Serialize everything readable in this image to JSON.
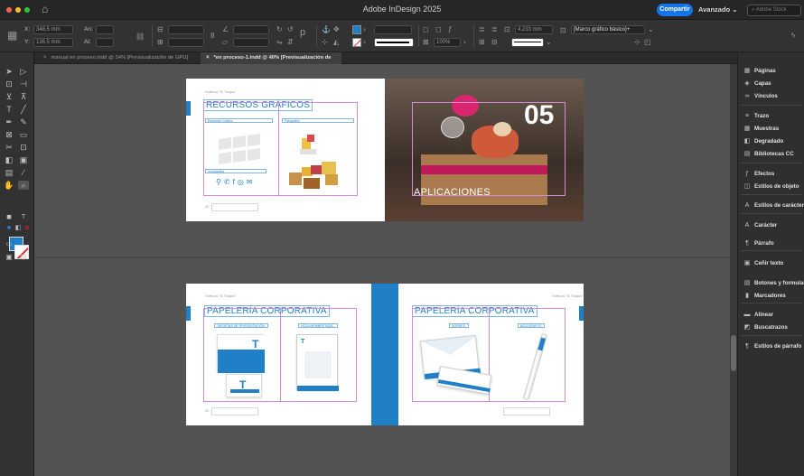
{
  "window": {
    "title": "Adobe InDesign 2025",
    "share_label": "Compartir",
    "workspace_label": "Avanzado",
    "stock_search_placeholder": "Adobe Stock",
    "traffic_colors": [
      "#fe5f57",
      "#febc2e",
      "#28c840"
    ]
  },
  "control_bar": {
    "x_label": "X:",
    "x_value": "348,5 mm",
    "y_label": "Y:",
    "y_value": "136,5 mm",
    "w_label": "An:",
    "h_label": "Al:",
    "stroke_weight": "4,233 mm",
    "zoom_percent": "100%",
    "frame_style": "[Marco gráfico básico]+"
  },
  "tabs": [
    {
      "label": "manual en proceso.indd @ 24% [Previsualización de GPU]",
      "active": false
    },
    {
      "label": "*en proceso-1.indd @ 40% [Previsualización de GPU]",
      "active": true
    }
  ],
  "tools": {
    "icons": [
      "selection-icon",
      "direct-selection-icon",
      "page-tool-icon",
      "gap-tool-icon",
      "content-collector-icon",
      "content-placer-icon",
      "type-tool-icon",
      "line-tool-icon",
      "pen-tool-icon",
      "pencil-tool-icon",
      "rectangle-frame-icon",
      "rectangle-icon",
      "scissors-icon",
      "free-transform-icon",
      "gradient-swatch-icon",
      "gradient-feather-icon",
      "note-icon",
      "eyedropper-icon",
      "hand-icon",
      "zoom-icon"
    ],
    "fill_color": "#1f7fc7",
    "stroke_color": "#ffffff"
  },
  "spread1": {
    "header_small": "Gráficos \"El Tinajon\"",
    "heading": "RECURSOS GRÁFICOS",
    "label_elements": "Elemento Gráfico",
    "label_photo": "Fotografía",
    "label_icon": "Iconografía",
    "number": "05",
    "section_title": "APLICACIONES",
    "footer_mark": "02"
  },
  "spread2": {
    "left_header_small": "Gráficos \"El Tinajon\"",
    "left_heading": "PAPELERÍA CORPORATIVA",
    "left_label_1": "TARJETAS DE PRESENTACIÓN",
    "left_label_2": "HOJA MEMBRETADA",
    "right_header_small": "Gráficos \"El Tinajon\"",
    "right_heading": "PAPELERÍA CORPORATIVA",
    "right_label_1": "SOBRES",
    "right_label_2": "BOLÍGRAFOS",
    "footer_mark": "02"
  },
  "panels": [
    {
      "icon": "pages-icon",
      "glyph": "▦",
      "label": "Páginas"
    },
    {
      "icon": "layers-icon",
      "glyph": "◈",
      "label": "Capas"
    },
    {
      "icon": "links-icon",
      "glyph": "∞",
      "label": "Vínculos"
    },
    {
      "icon": "stroke-icon",
      "glyph": "≡",
      "label": "Trazo"
    },
    {
      "icon": "swatches-icon",
      "glyph": "▦",
      "label": "Muestras"
    },
    {
      "icon": "gradient-icon",
      "glyph": "◧",
      "label": "Degradado"
    },
    {
      "icon": "cc-libraries-icon",
      "glyph": "▤",
      "label": "Bibliotecas CC"
    },
    {
      "icon": "effects-icon",
      "glyph": "ƒ",
      "label": "Efectos"
    },
    {
      "icon": "object-styles-icon",
      "glyph": "◫",
      "label": "Estilos de objeto"
    },
    {
      "icon": "character-styles-icon",
      "glyph": "A",
      "label": "Estilos de carácter"
    },
    {
      "icon": "character-icon",
      "glyph": "A",
      "label": "Carácter"
    },
    {
      "icon": "paragraph-icon",
      "glyph": "¶",
      "label": "Párrafo"
    },
    {
      "icon": "text-wrap-icon",
      "glyph": "▣",
      "label": "Ceñir texto"
    },
    {
      "icon": "buttons-forms-icon",
      "glyph": "▤",
      "label": "Botones y formularios"
    },
    {
      "icon": "bookmarks-icon",
      "glyph": "▮",
      "label": "Marcadores"
    },
    {
      "icon": "align-icon",
      "glyph": "▬",
      "label": "Alinear"
    },
    {
      "icon": "pathfinder-icon",
      "glyph": "◩",
      "label": "Buscatrazos"
    },
    {
      "icon": "paragraph-styles-icon",
      "glyph": "¶",
      "label": "Estilos de párrafo"
    }
  ]
}
